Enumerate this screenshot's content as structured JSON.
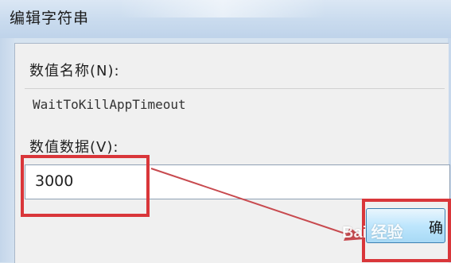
{
  "window": {
    "title": "编辑字符串"
  },
  "form": {
    "value_name_label": "数值名称(N):",
    "value_name": "WaitToKillAppTimeout",
    "value_data_label": "数值数据(V):",
    "value_data": "3000"
  },
  "buttons": {
    "ok_label": "确"
  },
  "annotations": {
    "highlight_color": "#d9363a",
    "arrow_color": "#c84a4f"
  },
  "watermark": {
    "text": "Bai 经验",
    "paw_icon": "paw-icon"
  }
}
